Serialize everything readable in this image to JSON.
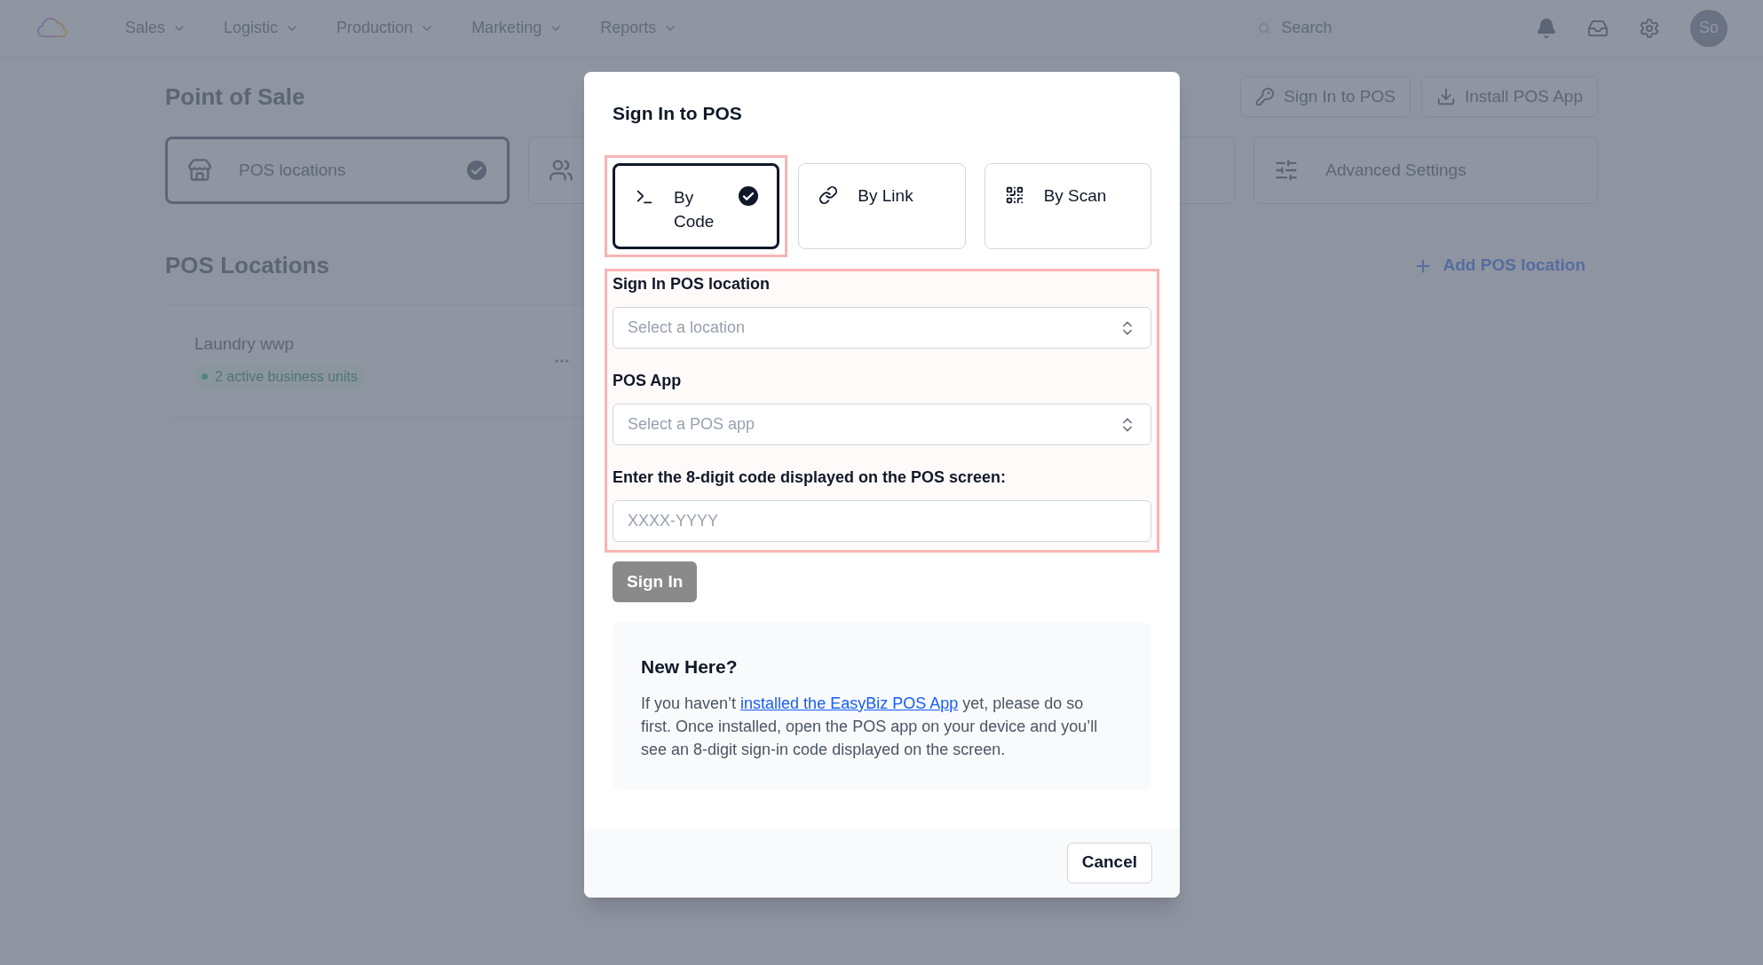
{
  "nav": {
    "menu": [
      {
        "label": "Sales"
      },
      {
        "label": "Logistic"
      },
      {
        "label": "Production"
      },
      {
        "label": "Marketing"
      },
      {
        "label": "Reports"
      }
    ],
    "search": {
      "placeholder": "Search"
    },
    "avatar": "So"
  },
  "page": {
    "title": "Point of Sale",
    "actions": [
      {
        "label": "Sign In to POS"
      },
      {
        "label": "Install POS App"
      }
    ]
  },
  "feature_cards": [
    {
      "label": "POS locations",
      "selected": true
    },
    {
      "selected": false
    },
    {
      "selected": false
    },
    {
      "label": "Advanced Settings",
      "selected": false
    }
  ],
  "locations": {
    "title": "POS Locations",
    "add_link": "Add POS location",
    "items": [
      {
        "name": "Laundry wwp",
        "badge": "2 active business units"
      }
    ]
  },
  "dialog": {
    "title": "Sign In to POS",
    "methods": [
      {
        "label": "By Code",
        "selected": true,
        "highlighted": true
      },
      {
        "label": "By Link",
        "selected": false,
        "highlighted": false
      },
      {
        "label": "By Scan",
        "selected": false,
        "highlighted": false
      }
    ],
    "form": {
      "highlighted": true,
      "fields": [
        {
          "kind": "select",
          "label": "Sign In POS location",
          "placeholder": "Select a location"
        },
        {
          "kind": "select",
          "label": "POS App",
          "placeholder": "Select a POS app"
        },
        {
          "kind": "text",
          "label": "Enter the 8-digit code displayed on the POS screen:",
          "placeholder": "XXXX-YYYY"
        }
      ]
    },
    "submit": {
      "label": "Sign In",
      "disabled": true
    },
    "help": {
      "title": "New Here?",
      "before": "If you haven’t ",
      "link": "installed the EasyBiz POS App",
      "after": " yet, please do so first. Once installed, open the POS app on your device and you’ll see an 8-digit sign-in code displayed on the screen."
    },
    "cancel": "Cancel"
  }
}
